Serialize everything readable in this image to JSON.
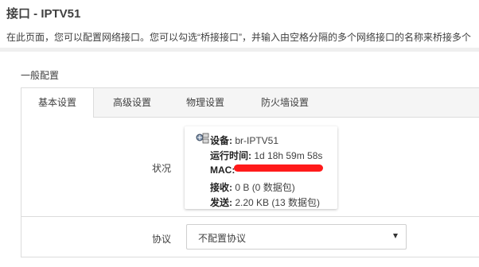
{
  "header": {
    "title": "接口 - IPTV51",
    "description": "在此页面，您可以配置网络接口。您可以勾选“桥接接口”，并输入由空格分隔的多个网络接口的名称来桥接多个"
  },
  "section": {
    "title": "一般配置"
  },
  "tabs": [
    {
      "label": "基本设置",
      "active": true
    },
    {
      "label": "高级设置",
      "active": false
    },
    {
      "label": "物理设置",
      "active": false
    },
    {
      "label": "防火墙设置",
      "active": false
    }
  ],
  "status": {
    "label": "状况",
    "icon": "network-device-icon",
    "device_key": "设备:",
    "device_value": "br-IPTV51",
    "uptime_key": "运行时间:",
    "uptime_value": "1d 18h 59m 58s",
    "mac_key": "MAC:",
    "rx_key": "接收:",
    "rx_value": "0 B (0 数据包)",
    "tx_key": "发送:",
    "tx_value": "2.20 KB (13 数据包)"
  },
  "protocol": {
    "label": "协议",
    "selected": "不配置协议"
  },
  "colors": {
    "redaction": "#ff1a1a",
    "tab_bar": "#f5f5f5",
    "border": "#dcdcdc"
  }
}
